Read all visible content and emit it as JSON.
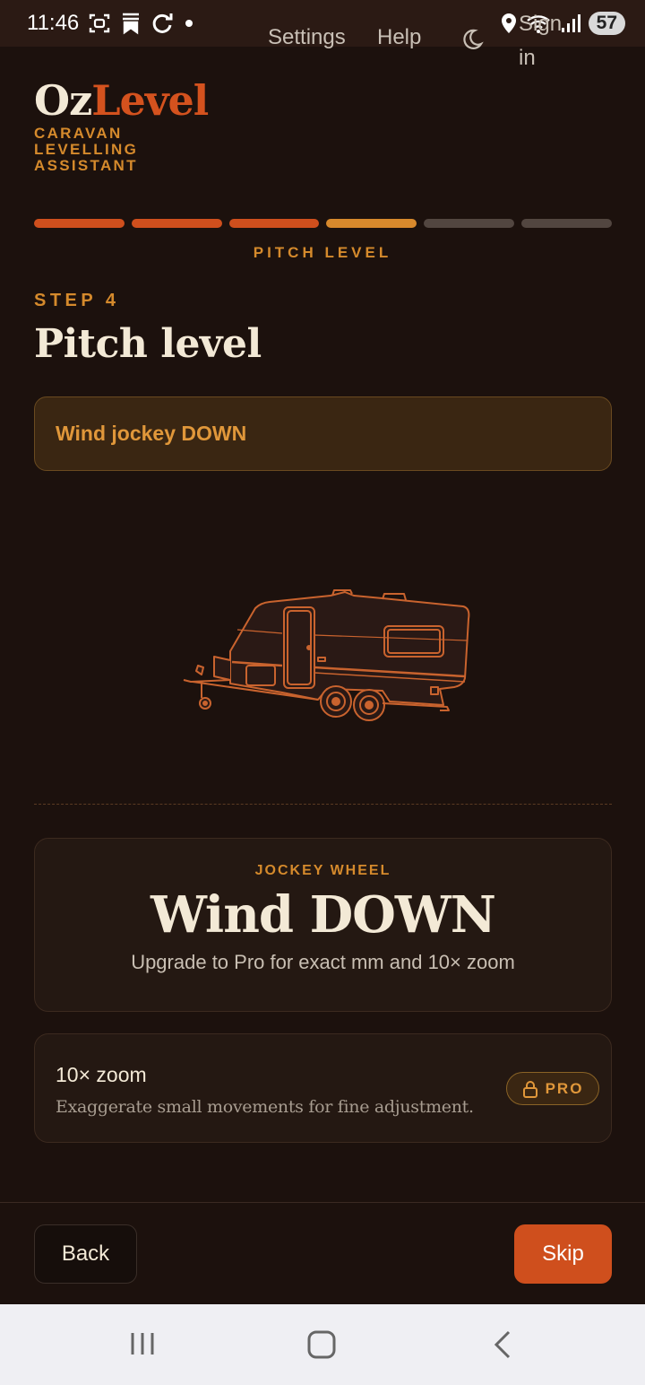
{
  "status_bar": {
    "time": "11:46",
    "battery": "57",
    "icons": [
      "screenshot-icon",
      "bookmark-icon",
      "sync-icon",
      "dot-icon",
      "location-icon",
      "wifi-icon",
      "signal-icon"
    ]
  },
  "header": {
    "logo_part1": "Oz",
    "logo_part2": "Level",
    "tagline": "CARAVAN LEVELLING ASSISTANT",
    "nav": {
      "settings": "Settings",
      "help": "Help",
      "theme_icon": "moon-icon",
      "sign_in": "Sign in"
    }
  },
  "progress": {
    "total_steps": 6,
    "current_step": 4,
    "current_label": "PITCH LEVEL",
    "colors": {
      "done": "#cf4f1d",
      "current": "#d8892c",
      "pending": "#524640"
    }
  },
  "step": {
    "number_label": "STEP 4",
    "title": "Pitch level"
  },
  "alert": {
    "text": "Wind jockey DOWN"
  },
  "illustration": {
    "icon": "caravan-icon"
  },
  "result_card": {
    "label": "JOCKEY WHEEL",
    "value": "Wind DOWN",
    "note": "Upgrade to Pro for exact mm and 10× zoom"
  },
  "zoom_option": {
    "title": "10× zoom",
    "description": "Exaggerate small movements for fine adjustment.",
    "badge": "PRO",
    "badge_icon": "lock-icon"
  },
  "footer": {
    "back_label": "Back",
    "skip_label": "Skip"
  },
  "system_nav": {
    "icons": [
      "recents-icon",
      "home-icon",
      "back-icon"
    ]
  }
}
